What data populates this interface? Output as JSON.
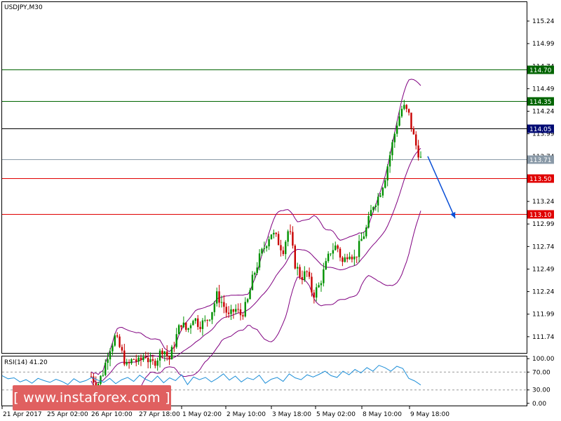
{
  "symbol": "USDJPY,M30",
  "rsi_label": "RSI(14) 41.20",
  "watermark": "[ www.instaforex.com ]",
  "colors": {
    "up": "#009100",
    "down": "#c80000",
    "bands": "#800080",
    "rsi": "#1e8fd8",
    "support": "#e00000",
    "resistance": "#006400",
    "pivot": "#000000",
    "current": "#8a9aa8",
    "arrow": "#0a4fd6",
    "tag_navy": "#000a73",
    "watermark": "#e06060"
  },
  "chart_data": {
    "type": "candlestick",
    "price_axis": {
      "ylim": [
        111.56,
        115.45
      ],
      "ticks": [
        "115.24",
        "114.99",
        "114.74",
        "114.49",
        "114.24",
        "113.99",
        "113.74",
        "113.49",
        "113.24",
        "112.99",
        "112.74",
        "112.49",
        "112.24",
        "111.99",
        "111.74"
      ]
    },
    "rsi_axis": {
      "ylim": [
        -5,
        105
      ],
      "ticks": [
        "100.00",
        "70.00",
        "30.00",
        "0.00"
      ],
      "levels": [
        70,
        30
      ],
      "value": 41.2
    },
    "x_ticks": [
      "21 Apr 2017",
      "25 Apr 02:00",
      "26 Apr 10:00",
      "27 Apr 18:00",
      "1 May 02:00",
      "2 May 10:00",
      "3 May 18:00",
      "5 May 02:00",
      "8 May 10:00",
      "9 May 18:00"
    ],
    "levels": [
      {
        "value": 114.7,
        "label": "114.70",
        "role": "resistance"
      },
      {
        "value": 114.35,
        "label": "114.35",
        "role": "resistance"
      },
      {
        "value": 114.05,
        "label": "114.05",
        "role": "pivot"
      },
      {
        "value": 113.71,
        "label": "113.71",
        "role": "current"
      },
      {
        "value": 113.5,
        "label": "113.50",
        "role": "support"
      },
      {
        "value": 113.1,
        "label": "113.10",
        "role": "support"
      }
    ],
    "arrow": {
      "from": 113.74,
      "to": 113.1
    },
    "close_path": [
      111.3,
      111.2,
      111.35,
      111.6,
      111.74,
      111.58,
      111.4,
      111.5,
      111.45,
      111.55,
      111.42,
      111.5,
      111.62,
      111.48,
      111.7,
      111.9,
      111.8,
      111.96,
      111.88,
      111.9,
      112.0,
      112.2,
      112.1,
      111.95,
      112.05,
      111.98,
      112.1,
      112.4,
      112.6,
      112.75,
      112.9,
      112.82,
      112.7,
      112.95,
      112.55,
      112.4,
      112.45,
      112.2,
      112.3,
      112.5,
      112.7,
      112.75,
      112.55,
      112.7,
      112.6,
      112.8,
      112.95,
      113.2,
      113.3,
      113.5,
      113.8,
      114.1,
      114.3,
      114.2,
      113.9,
      113.71
    ],
    "rsi": [
      62,
      55,
      57,
      48,
      53,
      45,
      56,
      51,
      47,
      54,
      49,
      42,
      55,
      47,
      51,
      58,
      52,
      47,
      56,
      44,
      53,
      58,
      49,
      63,
      54,
      48,
      61,
      46,
      57,
      51,
      64,
      42,
      59,
      53,
      58,
      48,
      56,
      66,
      52,
      61,
      48,
      57,
      53,
      63,
      45,
      54,
      58,
      49,
      66,
      57,
      53,
      64,
      59,
      65,
      72,
      62,
      58,
      72,
      64,
      76,
      68,
      80,
      72,
      85,
      80,
      72,
      83,
      78,
      56,
      50,
      41
    ]
  }
}
